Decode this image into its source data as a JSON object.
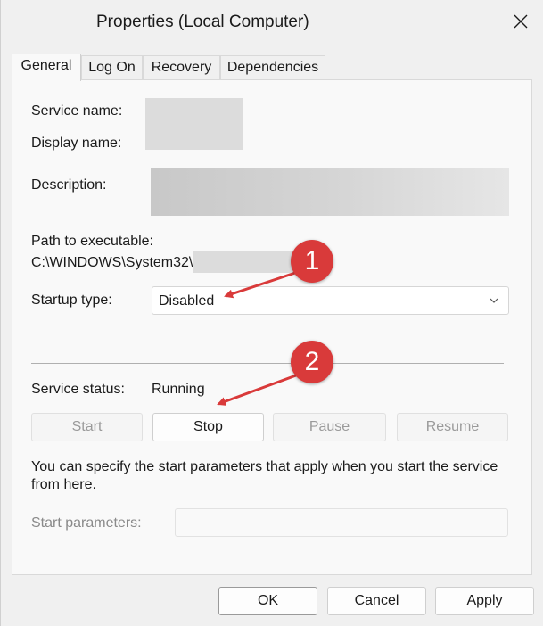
{
  "window": {
    "title": "Properties (Local Computer)"
  },
  "tabs": [
    "General",
    "Log On",
    "Recovery",
    "Dependencies"
  ],
  "general": {
    "service_name_label": "Service name:",
    "display_name_label": "Display name:",
    "description_label": "Description:",
    "path_label": "Path to executable:",
    "path_value": "C:\\WINDOWS\\System32\\",
    "startup_type_label": "Startup type:",
    "startup_type_value": "Disabled",
    "service_status_label": "Service status:",
    "service_status_value": "Running",
    "buttons": {
      "start": "Start",
      "stop": "Stop",
      "pause": "Pause",
      "resume": "Resume"
    },
    "hint": "You can specify the start parameters that apply when you start the service from here.",
    "start_params_label": "Start parameters:"
  },
  "dialog_buttons": {
    "ok": "OK",
    "cancel": "Cancel",
    "apply": "Apply"
  },
  "annotations": {
    "callout_1": "1",
    "callout_2": "2"
  },
  "colors": {
    "annotation_red": "#d93a3a"
  }
}
